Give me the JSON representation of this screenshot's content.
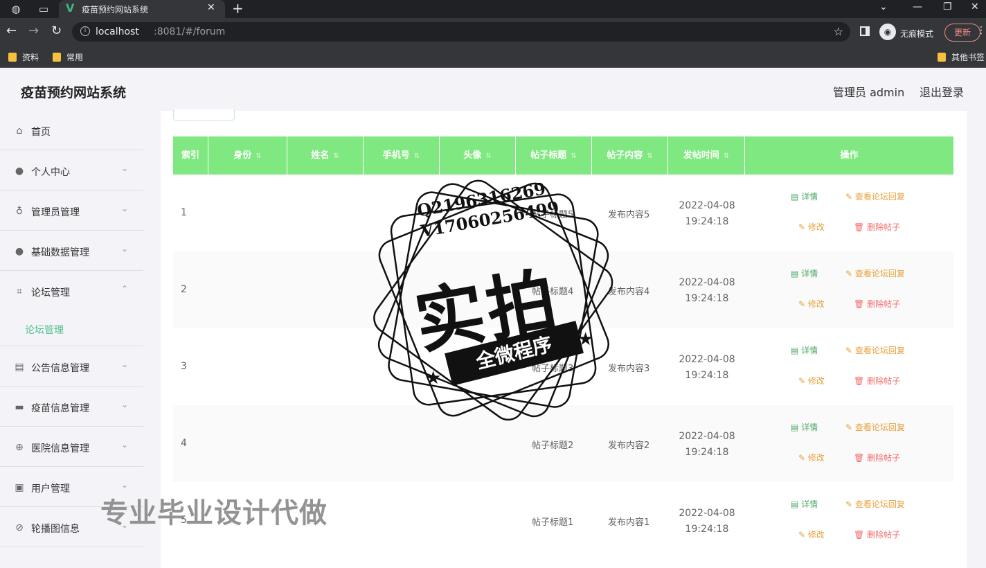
{
  "browser": {
    "tab_title": "疫苗预约网站系统",
    "url_host": "localhost",
    "url_path": ":8081/#/forum",
    "incognito_label": "无痕模式",
    "update_label": "更新",
    "bookmarks": [
      "资料",
      "常用"
    ],
    "other_bookmarks": "其他书签"
  },
  "header": {
    "app_title": "疫苗预约网站系统",
    "admin_label": "管理员 admin",
    "logout_label": "退出登录"
  },
  "sidebar": {
    "items": [
      {
        "label": "首页",
        "icon": "home-icon"
      },
      {
        "label": "个人中心",
        "icon": "user-icon"
      },
      {
        "label": "管理员管理",
        "icon": "mic-icon"
      },
      {
        "label": "基础数据管理",
        "icon": "user-icon"
      },
      {
        "label": "论坛管理",
        "icon": "crop-icon"
      },
      {
        "label": "公告信息管理",
        "icon": "chart-icon"
      },
      {
        "label": "疫苗信息管理",
        "icon": "monitor-icon"
      },
      {
        "label": "医院信息管理",
        "icon": "globe-icon"
      },
      {
        "label": "用户管理",
        "icon": "clipboard-icon"
      },
      {
        "label": "轮播图信息",
        "icon": "compass-icon"
      }
    ],
    "active_sub": "论坛管理"
  },
  "table": {
    "headers": [
      "索引",
      "身份",
      "姓名",
      "手机号",
      "头像",
      "帖子标题",
      "帖子内容",
      "发帖时间",
      "操作"
    ],
    "rows": [
      {
        "index": "1",
        "title": "帖子标题5",
        "content": "发布内容5",
        "date": "2022-04-08",
        "time": "19:24:18"
      },
      {
        "index": "2",
        "title": "帖子标题4",
        "content": "发布内容4",
        "date": "2022-04-08",
        "time": "19:24:18"
      },
      {
        "index": "3",
        "title": "帖子标题3",
        "content": "发布内容3",
        "date": "2022-04-08",
        "time": "19:24:18"
      },
      {
        "index": "4",
        "title": "帖子标题2",
        "content": "发布内容2",
        "date": "2022-04-08",
        "time": "19:24:18"
      },
      {
        "index": "5",
        "title": "帖子标题1",
        "content": "发布内容1",
        "date": "2022-04-08",
        "time": "19:24:18"
      }
    ],
    "actions": {
      "detail": "详情",
      "view_replies": "查看论坛回复",
      "edit": "修改",
      "delete": "删除帖子"
    }
  },
  "watermark": {
    "line1": "Q2196316269",
    "line2": "V17060256499",
    "big": "实拍",
    "ribbon": "全微程序",
    "bottom": "专业毕业设计代做"
  },
  "colors": {
    "header_green": "#80e880",
    "active_green": "#4fc08d",
    "warning": "#e6a23c",
    "danger": "#f56c6c"
  }
}
